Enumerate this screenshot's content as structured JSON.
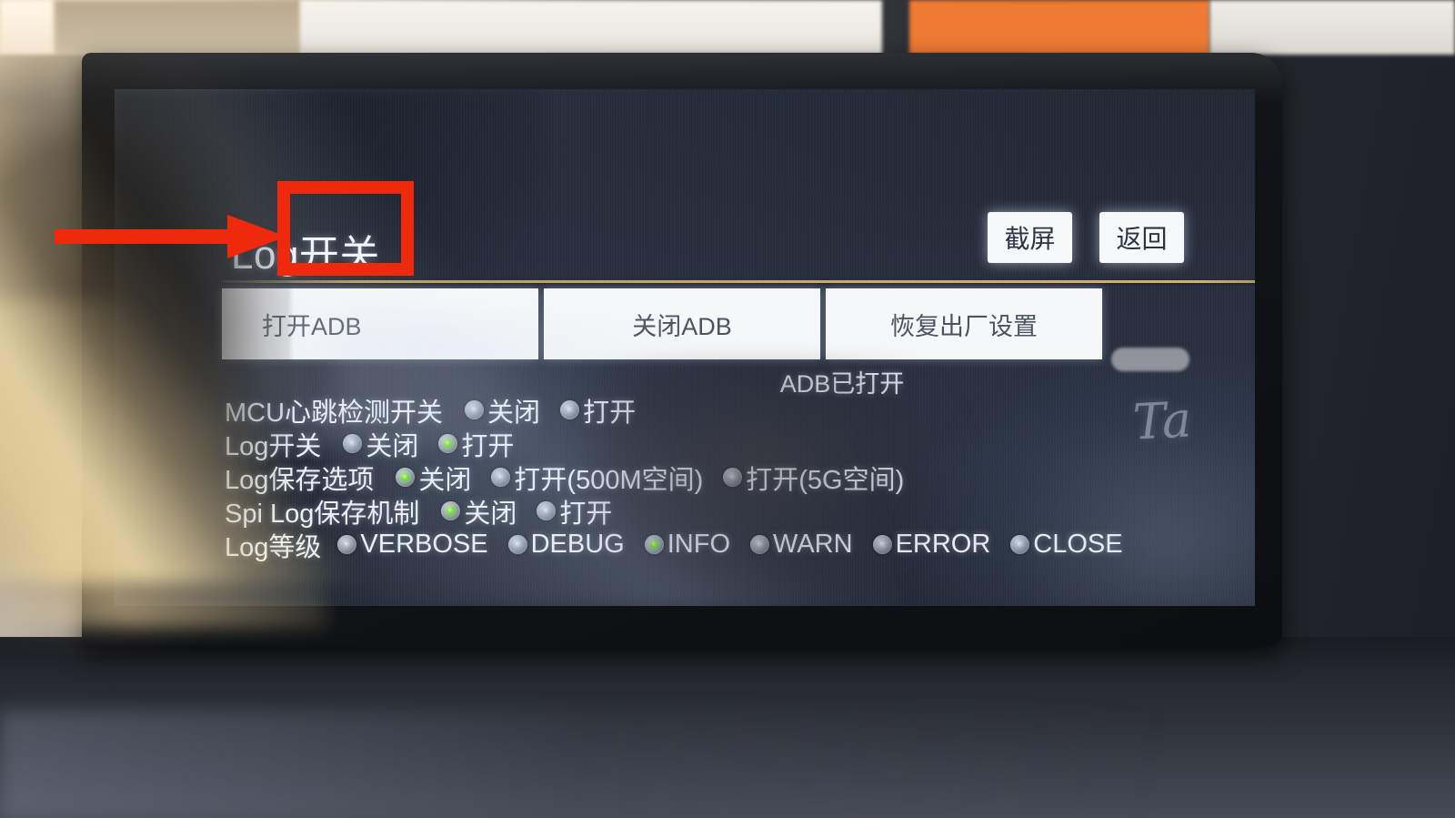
{
  "screen": {
    "title": "Log开关",
    "top_actions": [
      {
        "name": "screenshot",
        "label": "截屏"
      },
      {
        "name": "back",
        "label": "返回"
      }
    ],
    "action_buttons": [
      {
        "name": "enable-adb",
        "label": "打开ADB",
        "highlighted": true
      },
      {
        "name": "disable-adb",
        "label": "关闭ADB",
        "highlighted": false
      },
      {
        "name": "factory-reset",
        "label": "恢复出厂设置",
        "highlighted": false
      }
    ],
    "adb_status": "ADB已打开",
    "settings": [
      {
        "name": "mcu-heartbeat-switch",
        "label": "MCU心跳检测开关",
        "options": [
          {
            "label": "关闭",
            "selected": false
          },
          {
            "label": "打开",
            "selected": false
          }
        ]
      },
      {
        "name": "log-switch",
        "label": "Log开关",
        "options": [
          {
            "label": "关闭",
            "selected": false
          },
          {
            "label": "打开",
            "selected": true
          }
        ]
      },
      {
        "name": "log-save-option",
        "label": "Log保存选项",
        "options": [
          {
            "label": "关闭",
            "selected": true
          },
          {
            "label": "打开(500M空间)",
            "selected": false
          },
          {
            "label": "打开(5G空间)",
            "selected": false
          }
        ]
      },
      {
        "name": "spi-log-save-mechanism",
        "label": "Spi Log保存机制",
        "options": [
          {
            "label": "关闭",
            "selected": true
          },
          {
            "label": "打开",
            "selected": false
          }
        ]
      },
      {
        "name": "log-level",
        "label": "Log等级",
        "options": [
          {
            "label": "VERBOSE",
            "selected": false
          },
          {
            "label": "DEBUG",
            "selected": false
          },
          {
            "label": "INFO",
            "selected": true
          },
          {
            "label": "WARN",
            "selected": false
          },
          {
            "label": "ERROR",
            "selected": false
          },
          {
            "label": "CLOSE",
            "selected": false
          }
        ]
      }
    ]
  },
  "annotations": {
    "highlight_color": "#ef2a0c",
    "arrow_icon": "right-arrow-icon",
    "box_target": "打开ADB"
  },
  "colors": {
    "selected_radio": "#46c70d",
    "unselected_radio": "#8d96a4",
    "button_face": "#f6f7f9",
    "divider_gold": "#caa85e",
    "screen_bg": "#283040",
    "ui_text": "#eef2f8"
  },
  "decor": {
    "brand_script": "Ta"
  }
}
